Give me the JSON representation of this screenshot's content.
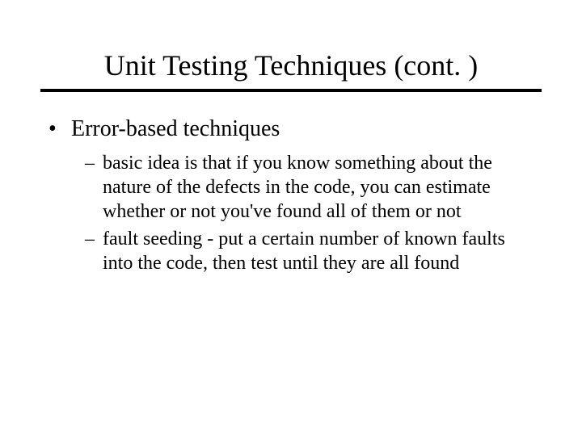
{
  "title": "Unit Testing Techniques (cont. )",
  "bullet1": {
    "marker": "•",
    "text": "Error-based techniques"
  },
  "sub1": {
    "marker": "–",
    "text": "basic idea is that if you know something about the nature of the defects in the code, you can estimate whether or not you've found all of them or not"
  },
  "sub2": {
    "marker": "–",
    "text": "fault seeding - put a certain number of known faults into the code, then test until they are all found"
  }
}
